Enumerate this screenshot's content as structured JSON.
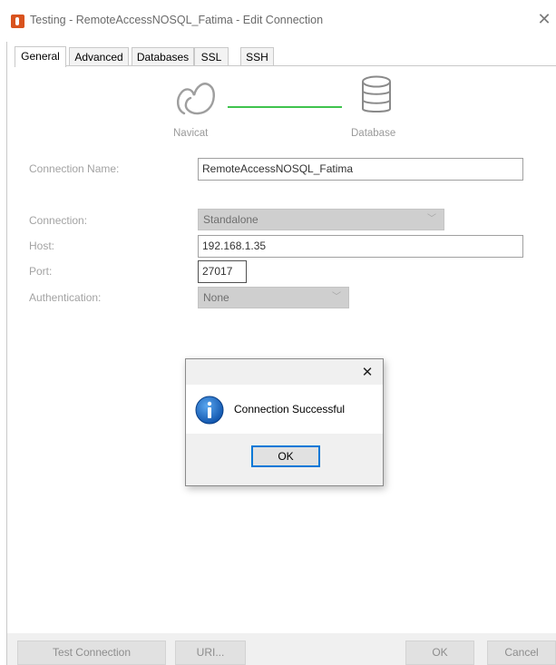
{
  "window": {
    "title": "Testing - RemoteAccessNOSQL_Fatima - Edit Connection",
    "close_glyph": "✕"
  },
  "tabs": [
    {
      "label": "General",
      "active": true
    },
    {
      "label": "Advanced",
      "active": false
    },
    {
      "label": "Databases",
      "active": false
    },
    {
      "label": "SSL",
      "active": false
    },
    {
      "label": "SSH",
      "active": false
    }
  ],
  "diagram": {
    "left_caption": "Navicat",
    "right_caption": "Database",
    "link_color": "#3fc34e",
    "left_icon": "navicat-logo-icon",
    "right_icon": "database-icon"
  },
  "form": {
    "connection_name": {
      "label": "Connection Name:",
      "value": "RemoteAccessNOSQL_Fatima"
    },
    "connection": {
      "label": "Connection:",
      "value": "Standalone"
    },
    "host": {
      "label": "Host:",
      "value": "192.168.1.35"
    },
    "port": {
      "label": "Port:",
      "value": "27017"
    },
    "authentication": {
      "label": "Authentication:",
      "value": "None"
    }
  },
  "buttons": {
    "test_connection": "Test Connection",
    "uri": "URI...",
    "ok": "OK",
    "cancel": "Cancel"
  },
  "message_box": {
    "text": "Connection Successful",
    "ok": "OK",
    "close_glyph": "✕",
    "icon": "info-icon",
    "accent": "#0078d7"
  }
}
